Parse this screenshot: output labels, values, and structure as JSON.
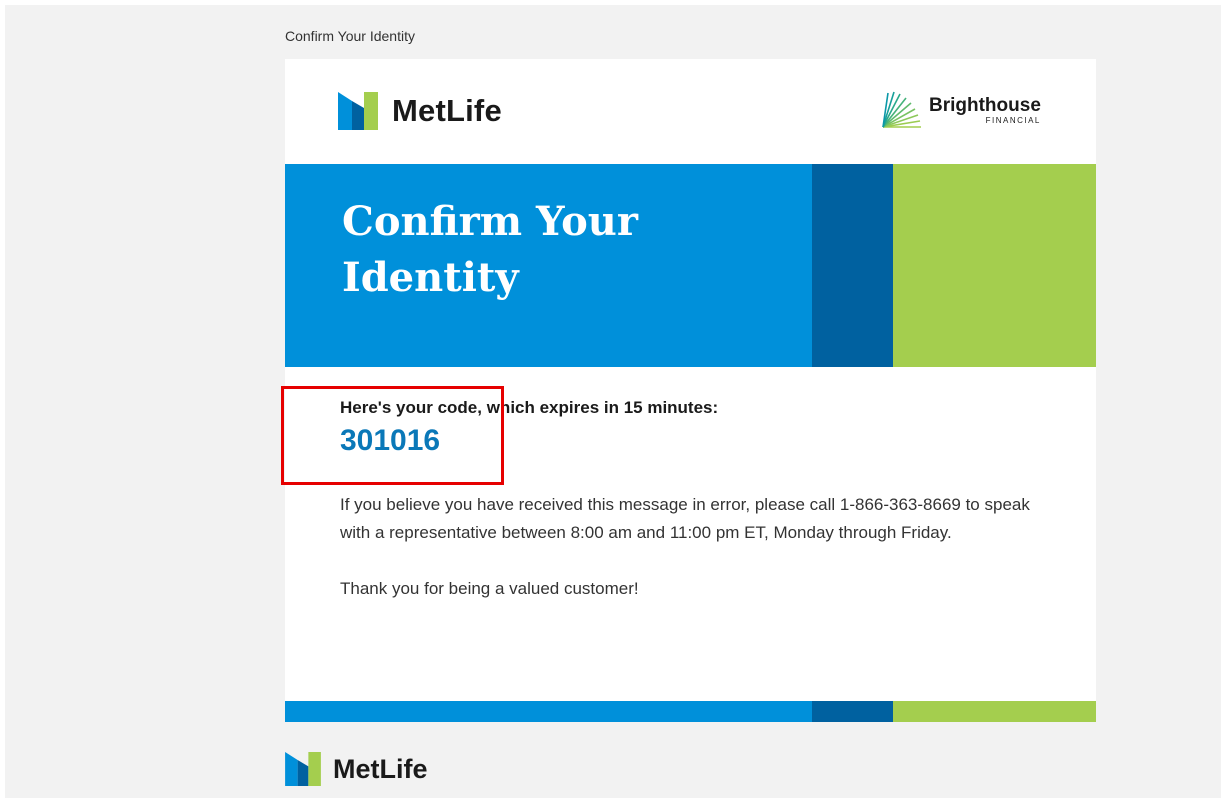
{
  "email": {
    "preheader": "Confirm Your Identity",
    "header": {
      "metlife_logo_text": "MetLife",
      "partner_logo_name": "Brighthouse",
      "partner_logo_sub": "FINANCIAL"
    },
    "banner": {
      "title": "Confirm Your Identity"
    },
    "body": {
      "code_intro": "Here's your code, which expires in 15 minutes:",
      "code": "301016",
      "error_notice": "If you believe you have received this message in error, please call 1-866-363-8669 to speak with a representative between 8:00 am and 11:00 pm ET, Monday through Friday.",
      "thanks": "Thank you for being a valued customer!"
    },
    "footer": {
      "metlife_logo_text": "MetLife"
    }
  },
  "colors": {
    "metlife_blue": "#0090da",
    "metlife_dark_blue": "#0061a0",
    "metlife_green": "#a4ce4e",
    "code_blue": "#0a78b8",
    "highlight_red": "#e60000"
  },
  "icons": {
    "metlife_logo": "metlife-logo-icon",
    "brighthouse_logo": "brighthouse-logo-icon"
  }
}
